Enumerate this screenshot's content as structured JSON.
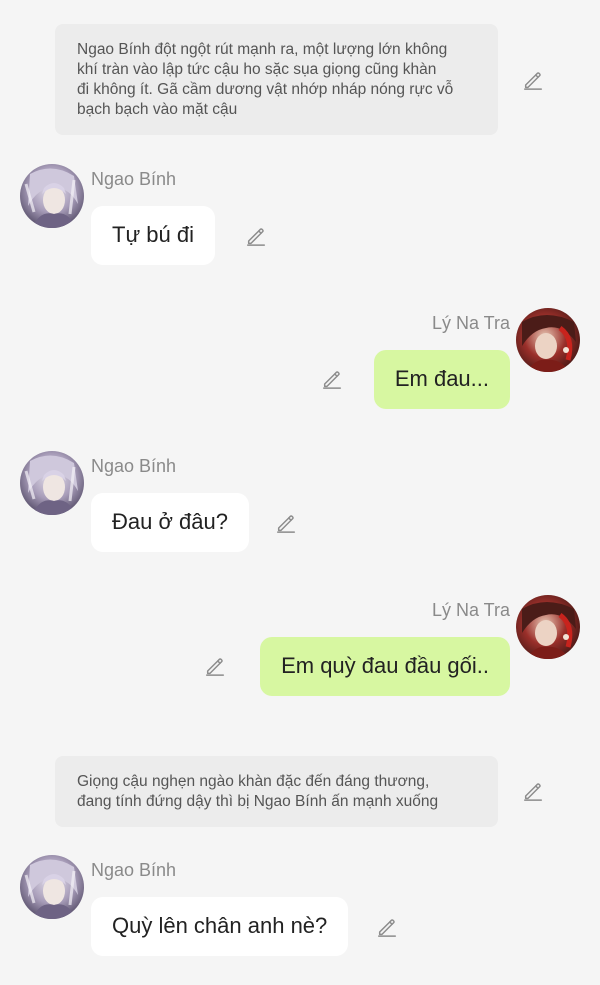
{
  "narrations": [
    {
      "text": "Ngao Bính đột ngột rút mạnh ra, một lượng lớn không\nkhí tràn vào lập tức cậu ho sặc sụa giọng cũng khàn\nđi không ít. Gã cầm dương vật nhớp nháp nóng rực vỗ\nbạch bạch vào mặt cậu"
    },
    {
      "text": "Giọng cậu nghẹn ngào khàn đặc đến đáng thương,\nđang tính đứng dậy thì bị Ngao Bính ấn mạnh xuống"
    }
  ],
  "messages": [
    {
      "sender": "Ngao Bính",
      "text": "Tự bú đi",
      "side": "left"
    },
    {
      "sender": "Lý Na Tra",
      "text": "Em đau...",
      "side": "right"
    },
    {
      "sender": "Ngao Bính",
      "text": "Đau ở đâu?",
      "side": "left"
    },
    {
      "sender": "Lý Na Tra",
      "text": "Em quỳ đau đầu gối..",
      "side": "right"
    },
    {
      "sender": "Ngao Bính",
      "text": "Quỳ lên chân anh nè?",
      "side": "left"
    }
  ],
  "icons": {
    "edit": "pencil-edit-icon",
    "avatar_ngao_binh": "avatar-ngao-binh",
    "avatar_ly_na_tra": "avatar-ly-na-tra"
  },
  "colors": {
    "page_background": "#f5f5f5",
    "narration_background": "#ececec",
    "incoming_bubble": "#ffffff",
    "outgoing_bubble": "#d7f7a1",
    "sender_name": "#8a8a8a",
    "icon": "#8c8c8c"
  }
}
